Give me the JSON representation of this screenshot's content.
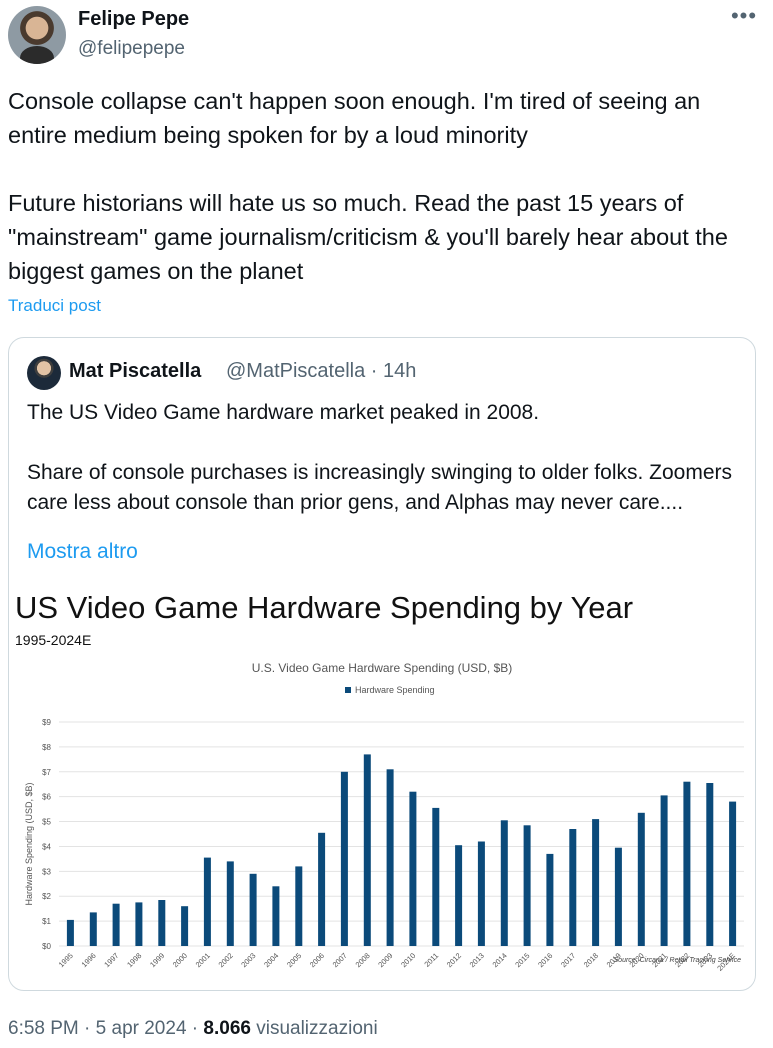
{
  "tweet": {
    "author_name": "Felipe Pepe",
    "author_handle": "@felipepepe",
    "more_icon": "more-horizontal-icon",
    "text": "Console collapse can't happen soon enough. I'm tired of seeing an entire medium being spoken for by a loud minority\n\nFuture historians will hate us so much. Read the past 15 years of \"mainstream\" game journalism/criticism & you'll barely hear about the biggest games on the planet",
    "translate_label": "Traduci post",
    "time": "6:58 PM",
    "separator": "·",
    "date": "5 apr 2024",
    "views_count": "8.066",
    "views_label": "visualizzazioni"
  },
  "quote": {
    "author_name": "Mat Piscatella",
    "author_handle": "@MatPiscatella · 14h",
    "text": "The US Video Game hardware market peaked in 2008.\n\nShare of console purchases is increasingly swinging to older folks. Zoomers care less about console than prior gens, and Alphas may never care....",
    "show_more_label": "Mostra altro",
    "image_title": "US Video Game Hardware Spending by Year",
    "image_subtitle": "1995-2024E"
  },
  "chart_data": {
    "type": "bar",
    "title": "U.S. Video Game Hardware Spending (USD, $B)",
    "ylabel": "Hardware Spending (USD, $B)",
    "xlabel": "",
    "source": "Source: Circana / Retail Tracking Service",
    "legend_position": "top-center",
    "grid": true,
    "ylim": [
      0,
      9
    ],
    "y_ticks": [
      "$0",
      "$1",
      "$2",
      "$3",
      "$4",
      "$5",
      "$6",
      "$7",
      "$8",
      "$9"
    ],
    "color": "#0b4a7a",
    "categories": [
      "1995",
      "1996",
      "1997",
      "1998",
      "1999",
      "2000",
      "2001",
      "2002",
      "2003",
      "2004",
      "2005",
      "2006",
      "2007",
      "2008",
      "2009",
      "2010",
      "2011",
      "2012",
      "2013",
      "2014",
      "2015",
      "2016",
      "2017",
      "2018",
      "2019",
      "2020",
      "2021",
      "2022",
      "2023",
      "2024E"
    ],
    "series": [
      {
        "name": "Hardware Spending",
        "values": [
          1.05,
          1.35,
          1.7,
          1.75,
          1.85,
          1.6,
          3.55,
          3.4,
          2.9,
          2.4,
          3.2,
          4.55,
          7.0,
          7.7,
          7.1,
          6.2,
          5.55,
          4.05,
          4.2,
          5.05,
          4.85,
          3.7,
          4.7,
          5.1,
          3.95,
          5.35,
          6.05,
          6.6,
          6.55,
          5.8
        ]
      }
    ]
  }
}
